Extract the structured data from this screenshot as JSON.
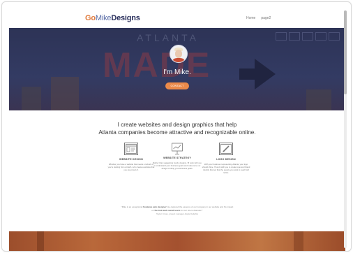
{
  "header": {
    "logo_go": "Go",
    "logo_mike": "Mike",
    "logo_designs": "Designs",
    "nav": [
      "Home",
      "page2"
    ]
  },
  "hero": {
    "background_word_top": "ATLANTA",
    "background_word": "MADE",
    "heading": "I'm Mike.",
    "contact_button": "CONTACT"
  },
  "intro": {
    "line1": "I create websites and design graphics that help",
    "line2": "Atlanta companies become attractive and recognizable online."
  },
  "services": [
    {
      "icon": "website-layout-icon",
      "title": "WEBSITE DESIGN",
      "desc": "Whether you have a website that needs a refresh or you're starting from scratch, let's create a website that you are proud of."
    },
    {
      "icon": "chart-presentation-icon",
      "title": "WEBSITE STRATEGY",
      "desc": "Rather than suggesting trendy designs, I'll work with you to understand your business goals and make sure our design is fitting your business goals."
    },
    {
      "icon": "pencil-logo-icon",
      "title": "LOGO DESIGN",
      "desc": "With your business representing Atlanta, your logo should shine. I'll work with you to create logo and brand identity that set that the people you want to reach will notice."
    }
  ],
  "quote": {
    "text_before": "\"Mike is an exceptional",
    "emphasis1": "freelance web designer",
    "text_mid": "! He captured the essence of our company in our website and his impact on",
    "emphasis2": "the look and overall users",
    "text_after": "for our site is dramatic.\"",
    "author": "Taylor Cross, project manager Apple Delights"
  },
  "colors": {
    "hero_bg": "#2d3356",
    "accent_orange": "#ec8a4a",
    "logo_navy": "#2a2f5c"
  }
}
